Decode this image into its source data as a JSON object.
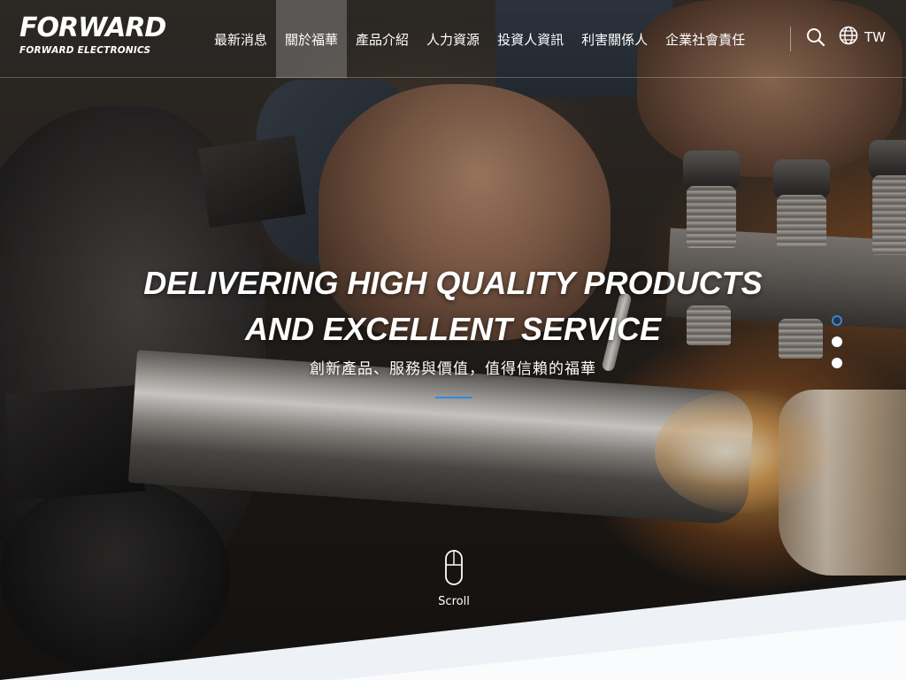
{
  "brand": {
    "logo_main": "FORWARD",
    "logo_sub": "FORWARD ELECTRONICS"
  },
  "nav": {
    "items": [
      {
        "label": "最新消息",
        "active": false
      },
      {
        "label": "關於福華",
        "active": true
      },
      {
        "label": "產品介紹",
        "active": false
      },
      {
        "label": "人力資源",
        "active": false
      },
      {
        "label": "投資人資訊",
        "active": false
      },
      {
        "label": "利害關係人",
        "active": false
      },
      {
        "label": "企業社會責任",
        "active": false
      }
    ],
    "search_icon": "search-icon",
    "language_icon": "globe-icon",
    "language_label": "TW"
  },
  "hero": {
    "title_line1": "DELIVERING HIGH QUALITY PRODUCTS",
    "title_line2": "AND EXCELLENT SERVICE",
    "subtitle": "創新產品、服務與價值，值得信賴的福華",
    "accent_color": "#2e8ae0",
    "slides": [
      {
        "active": true
      },
      {
        "active": false
      },
      {
        "active": false
      }
    ]
  },
  "scroll": {
    "label": "Scroll",
    "icon": "mouse-icon"
  },
  "colors": {
    "accent": "#2e8ae0",
    "bottom_band": "#eef1f6"
  }
}
